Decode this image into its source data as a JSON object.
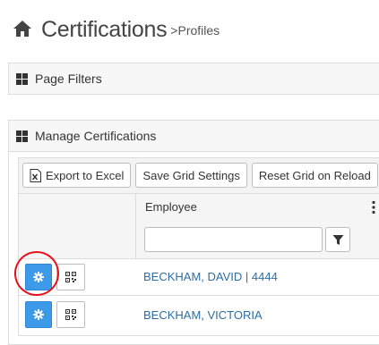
{
  "breadcrumb": {
    "title": "Certifications",
    "separator": ">",
    "current": "Profiles",
    "icon": "home-icon"
  },
  "panels": {
    "filters": {
      "title": "Page Filters",
      "icon": "grid-icon"
    },
    "manage": {
      "title": "Manage Certifications",
      "icon": "grid-icon"
    }
  },
  "toolbar": {
    "export_label": "Export to Excel",
    "save_label": "Save Grid Settings",
    "reset_label": "Reset Grid on Reload"
  },
  "grid": {
    "columns": [
      {
        "label": "Employee"
      }
    ],
    "filter": {
      "value": "",
      "icon": "filter-icon"
    },
    "rows": [
      {
        "employee": "BECKHAM, DAVID | 4444",
        "actions": [
          "gear-icon",
          "qr-code-icon"
        ],
        "highlighted": true
      },
      {
        "employee": "BECKHAM, VICTORIA",
        "actions": [
          "gear-icon",
          "qr-code-icon"
        ],
        "highlighted": false
      }
    ]
  },
  "colors": {
    "action_blue": "#3d9ae8",
    "link_blue": "#2e6da4",
    "annotation_red": "#e8101a"
  }
}
